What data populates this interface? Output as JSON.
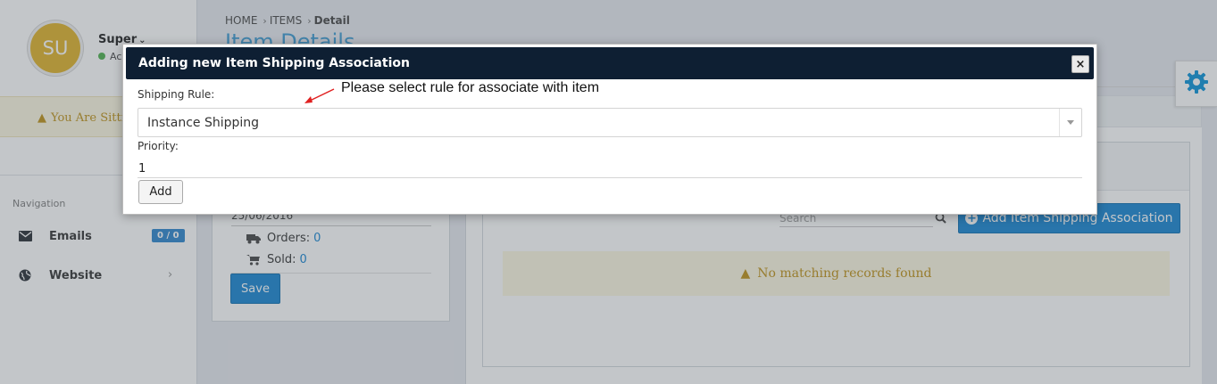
{
  "user": {
    "initials": "SU",
    "name": "Super",
    "status": "Ac"
  },
  "banner": {
    "text": "You Are Sitti"
  },
  "navigation": {
    "title": "Navigation",
    "items": [
      {
        "label": "Emails",
        "badge": "0 / 0",
        "icon": "envelope-icon"
      },
      {
        "label": "Website",
        "icon": "globe-icon"
      }
    ]
  },
  "breadcrumb": {
    "home": "HOME",
    "items": "ITEMS",
    "current": "Detail"
  },
  "page": {
    "title": "Item Details"
  },
  "item_card": {
    "date": "25/06/2016",
    "orders_label": "Orders:",
    "orders_value": "0",
    "sold_label": "Sold:",
    "sold_value": "0",
    "save_label": "Save"
  },
  "associations": {
    "search_placeholder": "Search",
    "add_label": "Add Item Shipping Association",
    "empty_message": "No matching records found"
  },
  "modal": {
    "title": "Adding new Item Shipping Association",
    "close_symbol": "×",
    "rule_label": "Shipping Rule:",
    "hint": "Please select rule for associate with item",
    "selected_rule": "Instance Shipping",
    "priority_label": "Priority:",
    "priority_value": "1",
    "add_label": "Add"
  },
  "colors": {
    "accent": "#2a8fd6",
    "modal_header": "#0e1f33",
    "warning_bg": "#fcf8e3",
    "warning_text": "#c49a2a",
    "avatar": "#e2b93b",
    "hint_arrow": "#e02020"
  }
}
